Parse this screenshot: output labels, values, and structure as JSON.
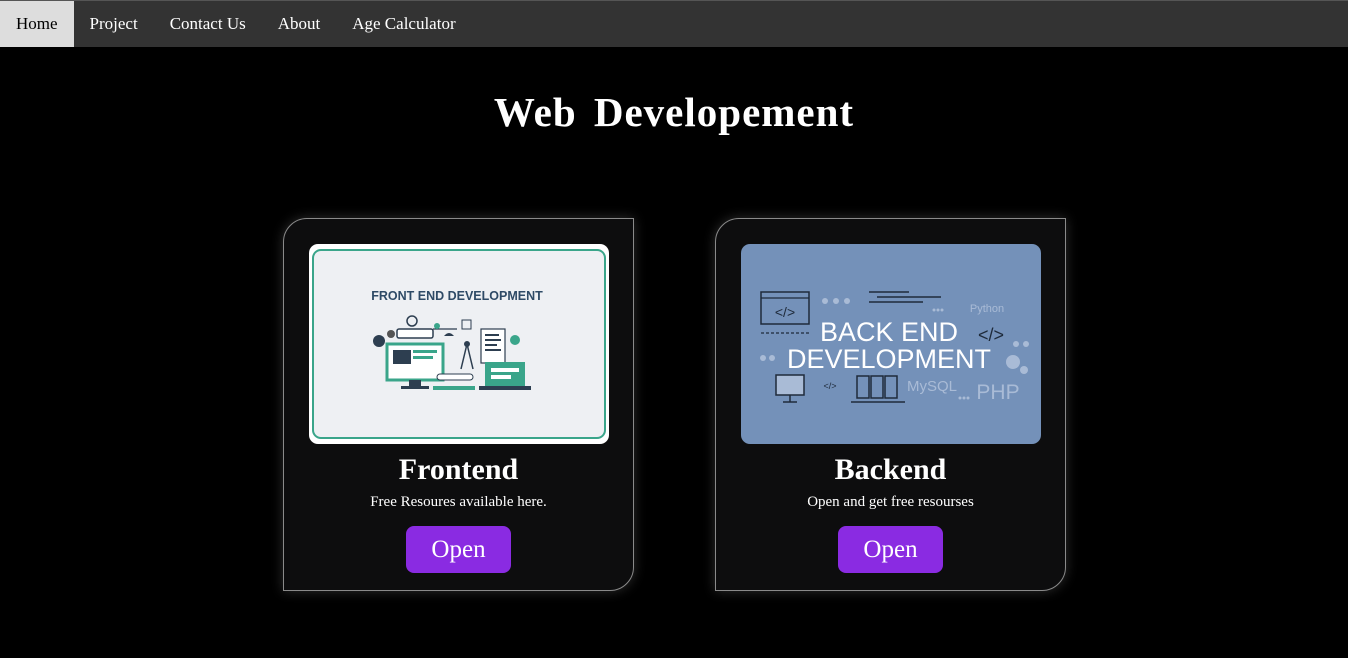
{
  "nav": {
    "items": [
      {
        "label": "Home",
        "active": true
      },
      {
        "label": "Project"
      },
      {
        "label": "Contact Us"
      },
      {
        "label": "About"
      },
      {
        "label": "Age Calculator"
      }
    ]
  },
  "page": {
    "title": "Web Developement"
  },
  "cards": [
    {
      "title": "Frontend",
      "description": "Free Resoures available here.",
      "button_label": "Open",
      "image": {
        "caption": "FRONT END DEVELOPMENT",
        "background": "#eef0f3",
        "border_color": "#3aa58a"
      }
    },
    {
      "title": "Backend",
      "description": "Open and get free resourses",
      "button_label": "Open",
      "image": {
        "line1": "BACK END",
        "line2": "DEVELOPMENT",
        "tag_python": "Python",
        "tag_mysql": "MySQL",
        "tag_php": "PHP",
        "code_tag": "</>",
        "background": "#7491b9"
      }
    }
  ],
  "colors": {
    "background": "#000000",
    "navbar": "#333333",
    "nav_active": "#dddddd",
    "card": "#0d0d0e",
    "button": "#8a2be2"
  }
}
